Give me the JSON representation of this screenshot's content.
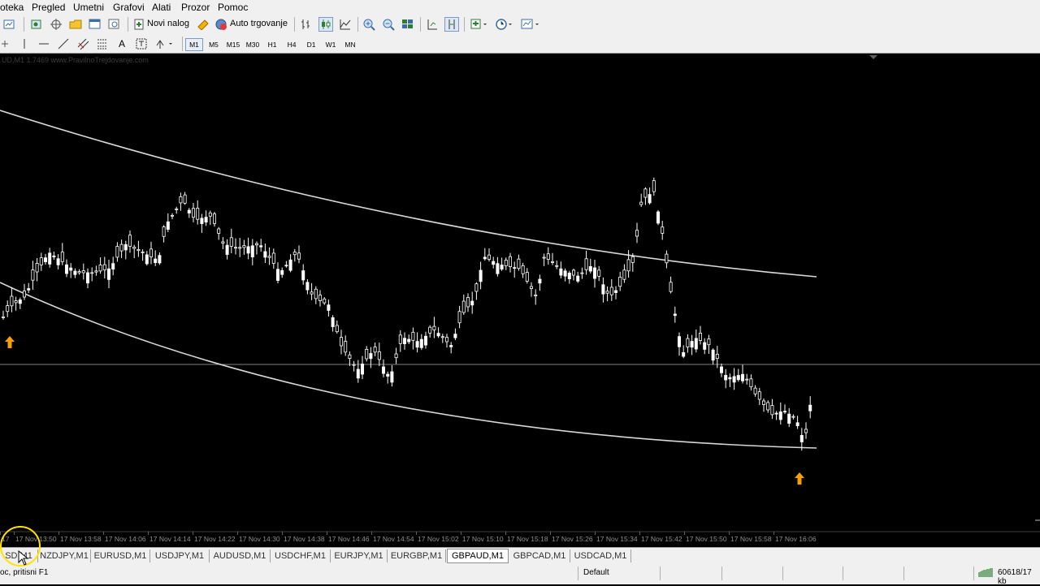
{
  "menu": [
    "oteka",
    "Pregled",
    "Umetni",
    "Grafovi",
    "Alati",
    "Prozor",
    "Pomoc"
  ],
  "toolbar": {
    "new_order": "Novi nalog",
    "auto_trading": "Auto trgovanje",
    "timeframes": [
      "M1",
      "M5",
      "M15",
      "M30",
      "H1",
      "H4",
      "D1",
      "W1",
      "MN"
    ],
    "active_timeframe": "M1"
  },
  "chart": {
    "info_text": "UD,M1  1.7469  www.PravilnoTrejdovanje.com",
    "horizontal_line_color": "#808080",
    "candle_color": "#ffffff",
    "bg_color": "#000000",
    "arrow_color": "#f5a000",
    "time_labels": [
      "17",
      "17 Nov 13:50",
      "17 Nov 13:58",
      "17 Nov 14:06",
      "17 Nov 14:14",
      "17 Nov 14:22",
      "17 Nov 14:30",
      "17 Nov 14:38",
      "17 Nov 14:46",
      "17 Nov 14:54",
      "17 Nov 15:02",
      "17 Nov 15:10",
      "17 Nov 15:18",
      "17 Nov 15:26",
      "17 Nov 15:34",
      "17 Nov 15:42",
      "17 Nov 15:50",
      "17 Nov 15:58",
      "17 Nov 16:06"
    ]
  },
  "tabs": [
    "SD,M1",
    "NZDJPY,M1",
    "EURUSD,M1",
    "USDJPY,M1",
    "AUDUSD,M1",
    "USDCHF,M1",
    "EURJPY,M1",
    "EURGBP,M1",
    "GBPAUD,M1",
    "GBPCAD,M1",
    "USDCAD,M1"
  ],
  "active_tab": "GBPAUD,M1",
  "status": {
    "help": "oc, pritisni F1",
    "profile": "Default",
    "traffic": "60618/17 kb"
  }
}
